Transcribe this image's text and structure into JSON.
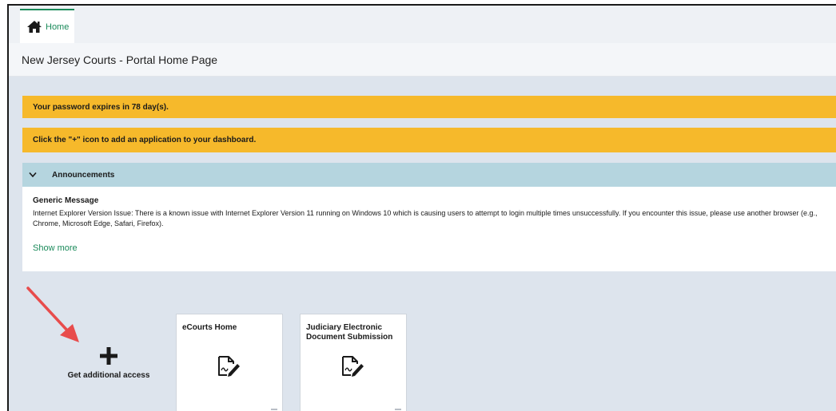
{
  "tabs": [
    {
      "label": "Home",
      "icon": "home-icon"
    }
  ],
  "page_title": "New Jersey Courts - Portal Home Page",
  "banners": [
    {
      "text": "Your password expires in 78 day(s)."
    },
    {
      "text": "Click the \"+\" icon to add an application to your dashboard."
    }
  ],
  "announcements": {
    "title": "Announcements",
    "message_title": "Generic Message",
    "message_text": "Internet Explorer Version Issue: There is a known issue with Internet Explorer Version 11 running on Windows 10 which is causing users to attempt to login multiple times unsuccessfully. If you encounter this issue, please use another browser (e.g., Chrome, Microsoft Edge, Safari, Firefox).",
    "show_more": "Show more"
  },
  "add_access": {
    "label": "Get additional access",
    "icon": "plus-icon"
  },
  "apps": [
    {
      "name": "eCourts Home",
      "icon": "document-edit-icon"
    },
    {
      "name": "Judiciary Electronic Document Submission",
      "icon": "document-edit-icon"
    }
  ],
  "colors": {
    "accent_green": "#1a8a5a",
    "banner_yellow": "#f6b92b",
    "announcement_blue": "#b5d5df",
    "arrow_red": "#e84c4c"
  }
}
